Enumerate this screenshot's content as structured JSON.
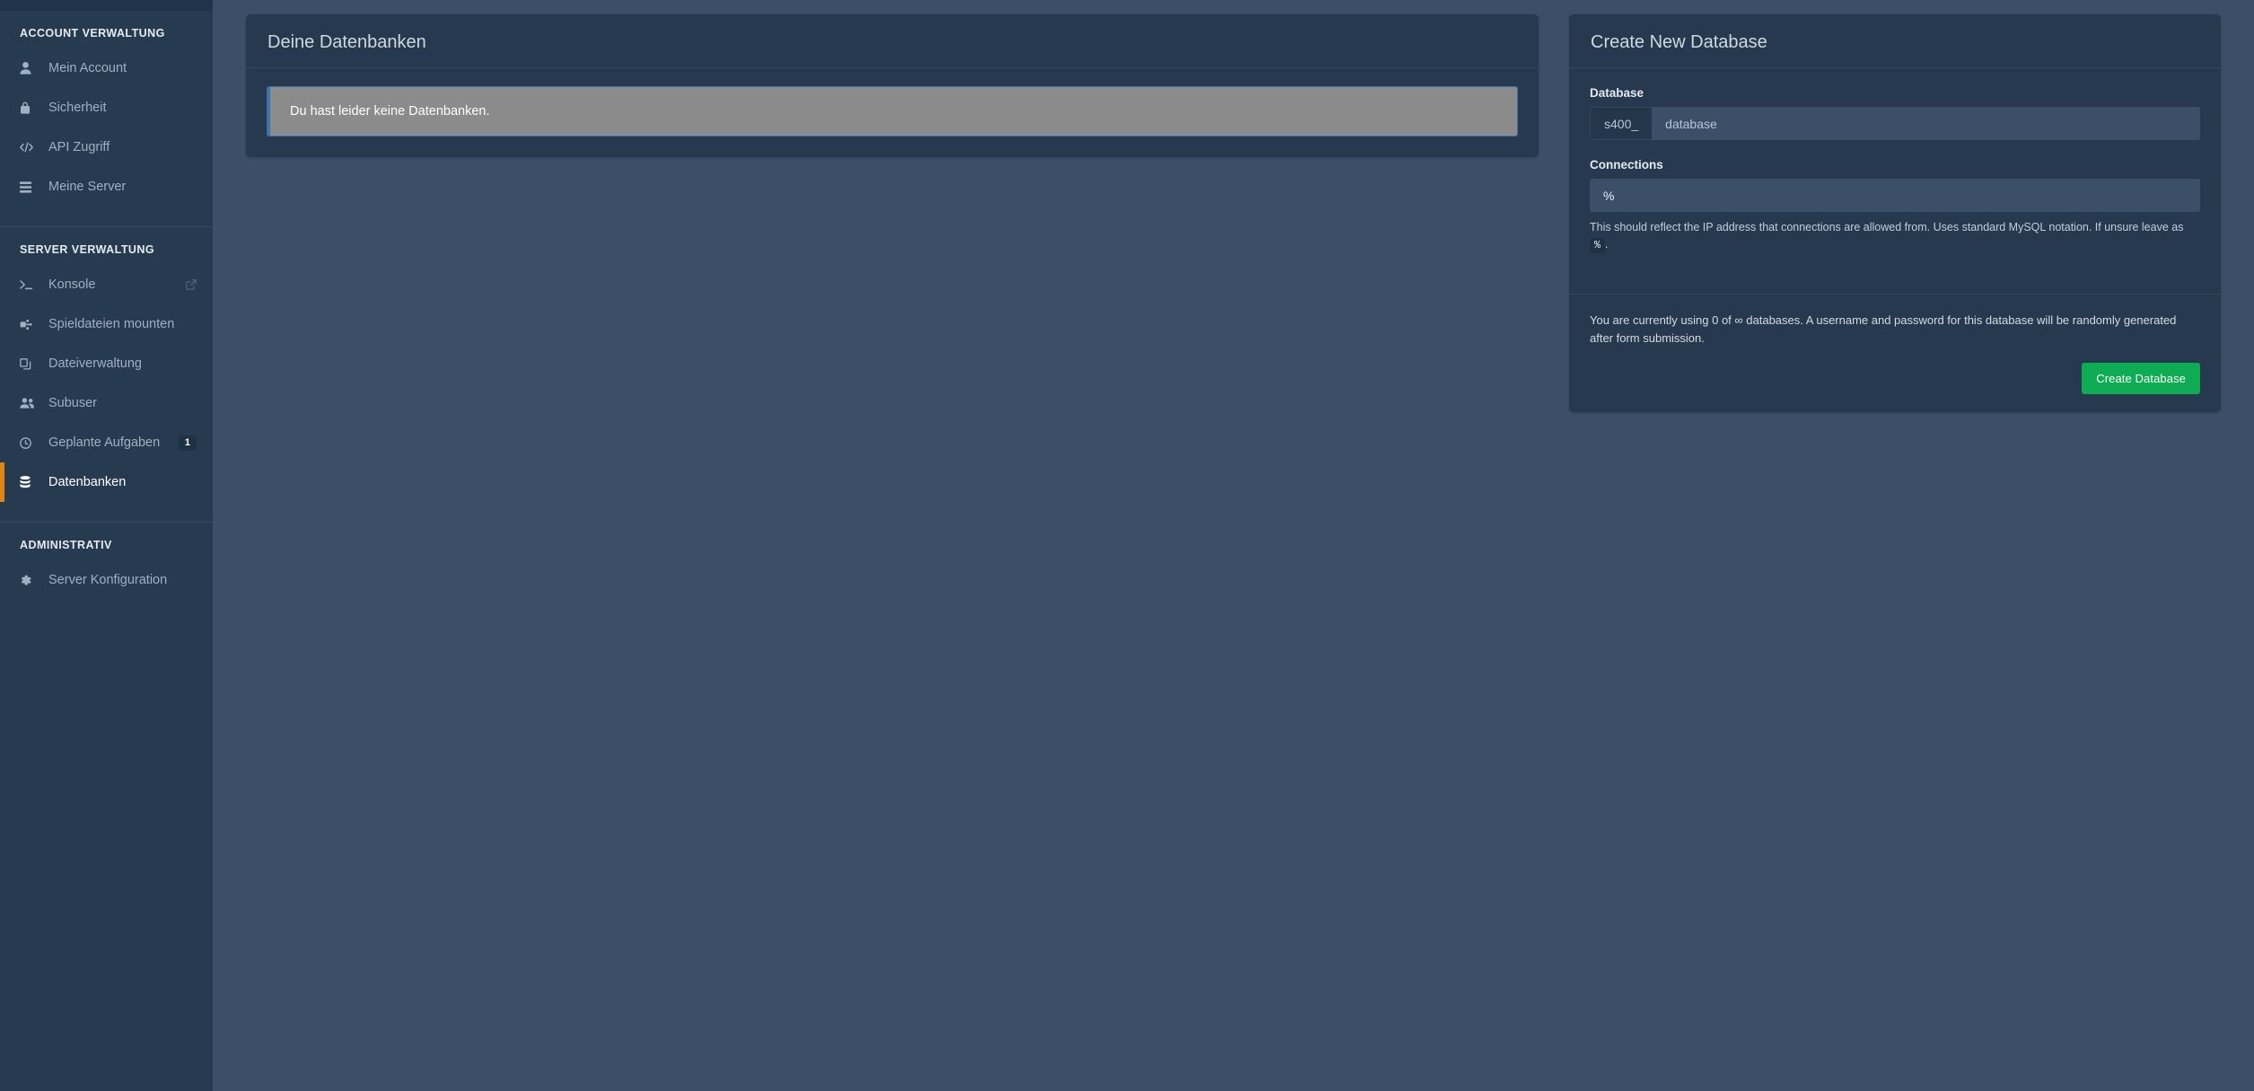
{
  "sidebar": {
    "sections": [
      {
        "heading": "ACCOUNT VERWALTUNG",
        "items": [
          {
            "label": "Mein Account",
            "icon": "user-icon",
            "badge": null,
            "external": false,
            "active": false
          },
          {
            "label": "Sicherheit",
            "icon": "lock-icon",
            "badge": null,
            "external": false,
            "active": false
          },
          {
            "label": "API Zugriff",
            "icon": "code-icon",
            "badge": null,
            "external": false,
            "active": false
          },
          {
            "label": "Meine Server",
            "icon": "server-icon",
            "badge": null,
            "external": false,
            "active": false
          }
        ]
      },
      {
        "heading": "SERVER VERWALTUNG",
        "items": [
          {
            "label": "Konsole",
            "icon": "terminal-icon",
            "badge": null,
            "external": true,
            "active": false
          },
          {
            "label": "Spieldateien mounten",
            "icon": "plug-icon",
            "badge": null,
            "external": false,
            "active": false
          },
          {
            "label": "Dateiverwaltung",
            "icon": "files-icon",
            "badge": null,
            "external": false,
            "active": false
          },
          {
            "label": "Subuser",
            "icon": "users-icon",
            "badge": null,
            "external": false,
            "active": false
          },
          {
            "label": "Geplante Aufgaben",
            "icon": "clock-icon",
            "badge": "1",
            "external": false,
            "active": false
          },
          {
            "label": "Datenbanken",
            "icon": "database-icon",
            "badge": null,
            "external": false,
            "active": true
          }
        ]
      },
      {
        "heading": "ADMINISTRATIV",
        "items": [
          {
            "label": "Server Konfiguration",
            "icon": "gear-icon",
            "badge": null,
            "external": false,
            "active": false
          }
        ]
      }
    ]
  },
  "databases_card": {
    "title": "Deine Datenbanken",
    "empty_alert": "Du hast leider keine Datenbanken."
  },
  "create_card": {
    "title": "Create New Database",
    "database_label": "Database",
    "database_prefix": "s400_",
    "database_placeholder": "database",
    "database_value": "",
    "connections_label": "Connections",
    "connections_value": "%",
    "connections_help_before": "This should reflect the IP address that connections are allowed from. Uses standard MySQL notation. If unsure leave as",
    "connections_help_code": "%",
    "connections_help_after": ".",
    "usage_note": "You are currently using 0 of ∞ databases. A username and password for this database will be randomly generated after form submission.",
    "submit_label": "Create Database"
  },
  "colors": {
    "sidebar_bg": "#263b50",
    "page_bg": "#3b5068",
    "card_bg": "#26394e",
    "accent_active": "#e08416",
    "button_green": "#0eac53",
    "alert_bg": "#8b8b8b",
    "alert_border": "#3e73b0"
  }
}
